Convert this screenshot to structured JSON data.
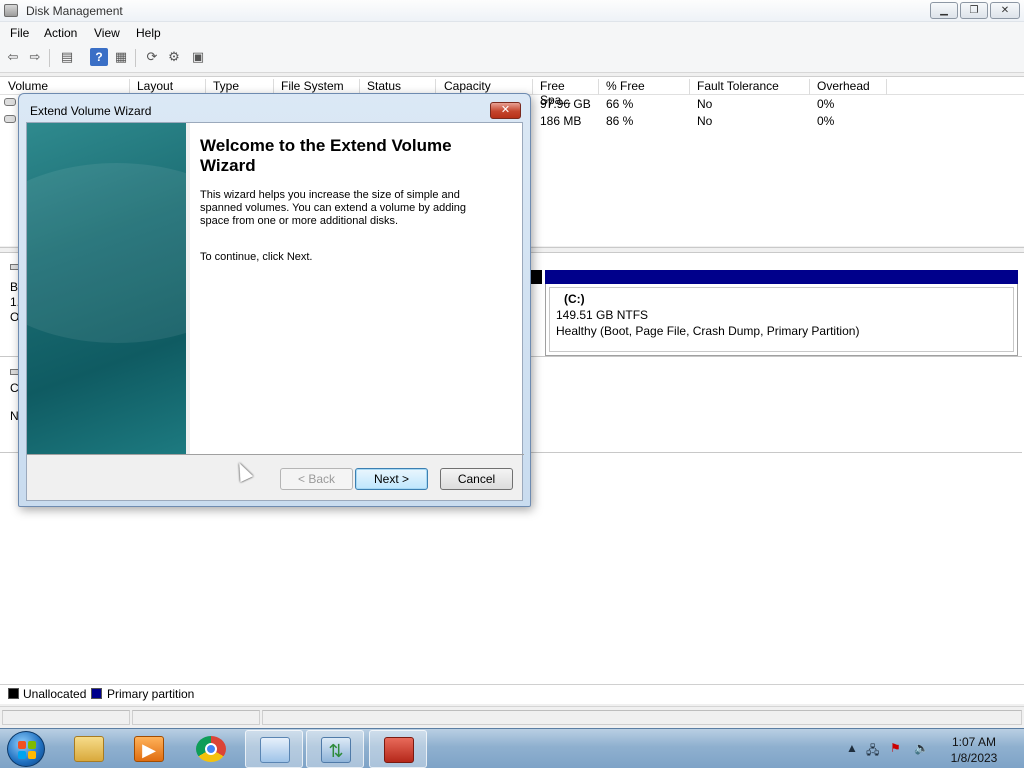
{
  "window": {
    "title": "Disk Management",
    "min": "▁",
    "max": "❐",
    "close": "✕"
  },
  "menu": [
    "File",
    "Action",
    "View",
    "Help"
  ],
  "toolbar": {
    "back": "⇦",
    "forward": "⇨",
    "help": "?"
  },
  "volumes": {
    "columns": [
      "Volume",
      "Layout",
      "Type",
      "File System",
      "Status",
      "Capacity",
      "Free Spa...",
      "% Free",
      "Fault Tolerance",
      "Overhead"
    ],
    "rows": [
      {
        "free": "97.96 GB",
        "pct": "66 %",
        "fault": "No",
        "overhead": "0%"
      },
      {
        "free": "186 MB",
        "pct": "86 %",
        "fault": "No",
        "overhead": "0%"
      }
    ]
  },
  "disk_left": {
    "b": "B",
    "one": "1.",
    "o": "O",
    "c": "C",
    "n": "N"
  },
  "partition": {
    "letter": "(C:)",
    "size": "149.51 GB NTFS",
    "status": "Healthy (Boot, Page File, Crash Dump, Primary Partition)"
  },
  "legend": [
    {
      "label": "Unallocated",
      "color": "#000000"
    },
    {
      "label": "Primary partition",
      "color": "#00008b"
    }
  ],
  "dialog": {
    "title": "Extend Volume Wizard",
    "close": "✕",
    "heading": "Welcome to the Extend Volume Wizard",
    "body": "This wizard helps you increase the size of simple and spanned volumes. You can extend a volume  by adding space from one or more additional disks.",
    "continue": "To continue, click Next.",
    "back": "< Back",
    "next": "Next >",
    "cancel": "Cancel"
  },
  "taskbar": {
    "apps": [
      "explorer",
      "media-player",
      "chrome",
      "control-panel",
      "network",
      "toolbox"
    ],
    "time": "1:07 AM",
    "date": "1/8/2023"
  }
}
